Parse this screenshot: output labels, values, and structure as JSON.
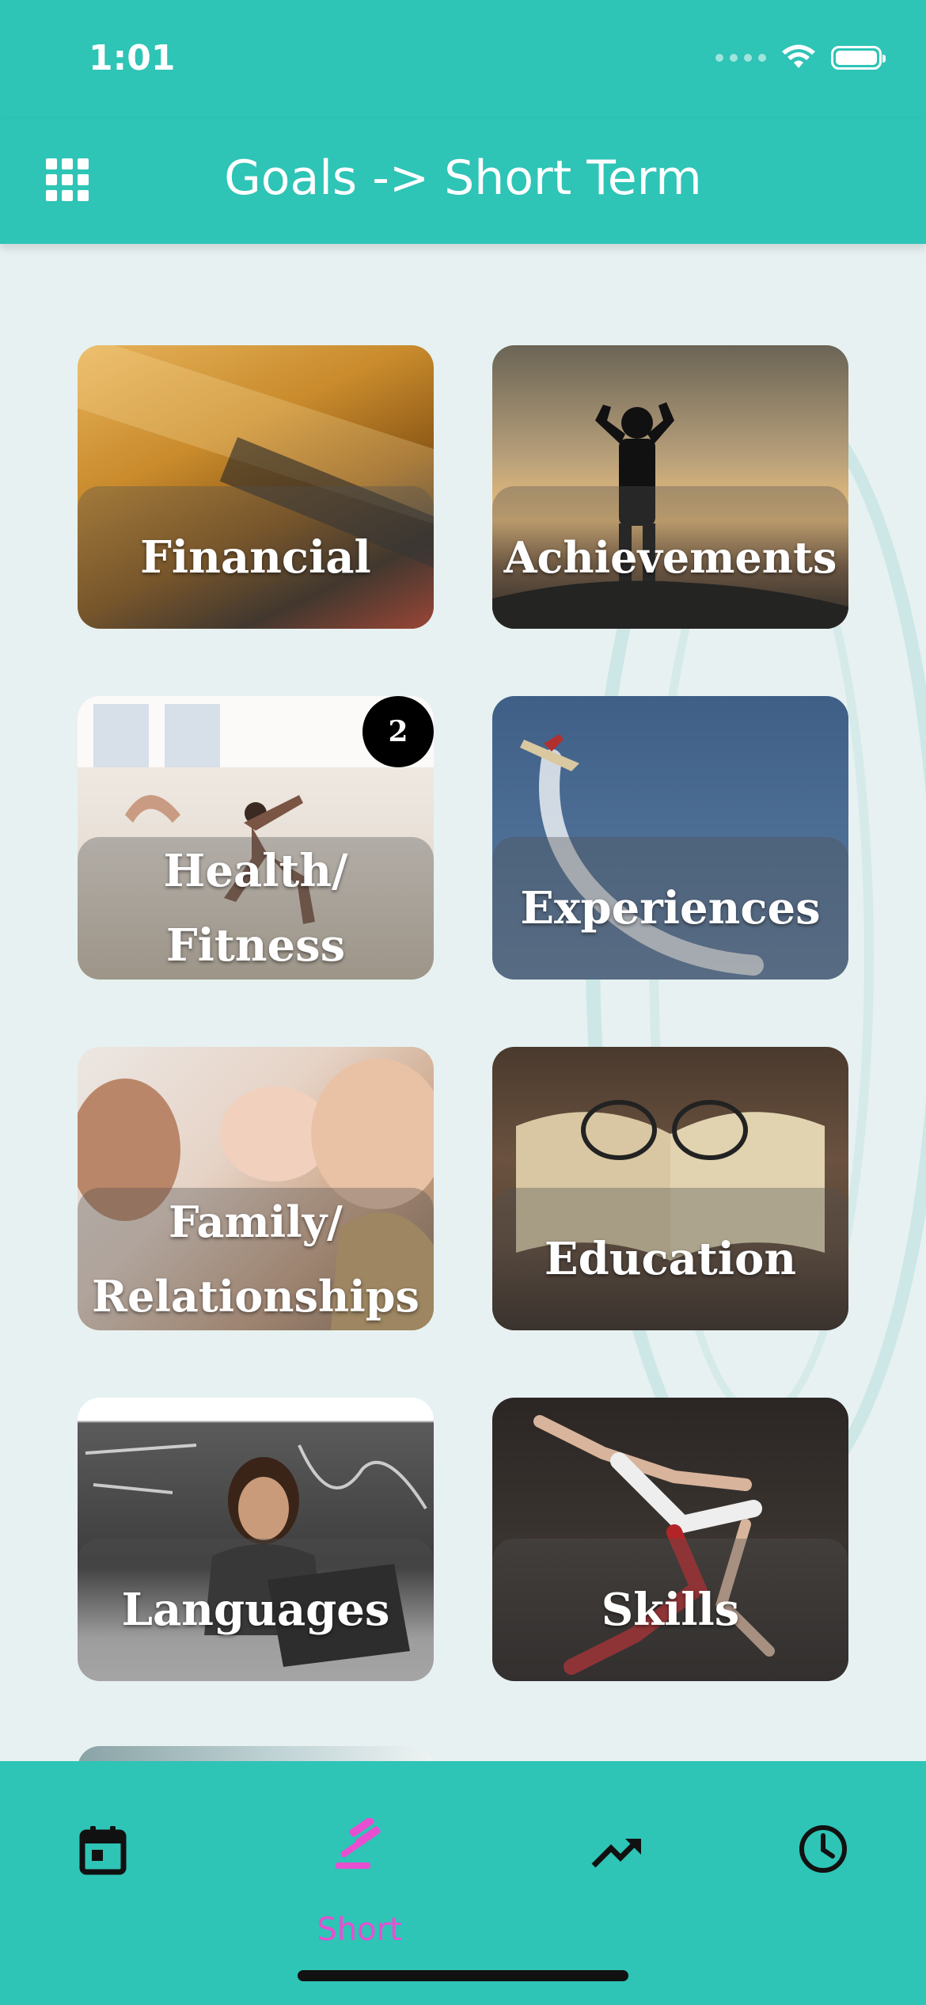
{
  "status_bar": {
    "time": "1:01"
  },
  "header": {
    "title": "Goals -> Short Term"
  },
  "categories": [
    {
      "label": "Financial"
    },
    {
      "label": "Achievements"
    },
    {
      "label": "Health/\nFitness",
      "badge": "2"
    },
    {
      "label": "Experiences"
    },
    {
      "label": "Family/\nRelationships"
    },
    {
      "label": "Education"
    },
    {
      "label": "Languages"
    },
    {
      "label": "Skills"
    }
  ],
  "bottom_nav": {
    "items": [
      {
        "icon": "calendar-icon"
      },
      {
        "icon": "gavel-icon",
        "label": "Short",
        "active": true
      },
      {
        "icon": "trending-up-icon"
      },
      {
        "icon": "clock-icon"
      }
    ]
  },
  "colors": {
    "primary": "#2ec4b6",
    "accent": "#e84fd0",
    "background": "#e7f1f1"
  }
}
